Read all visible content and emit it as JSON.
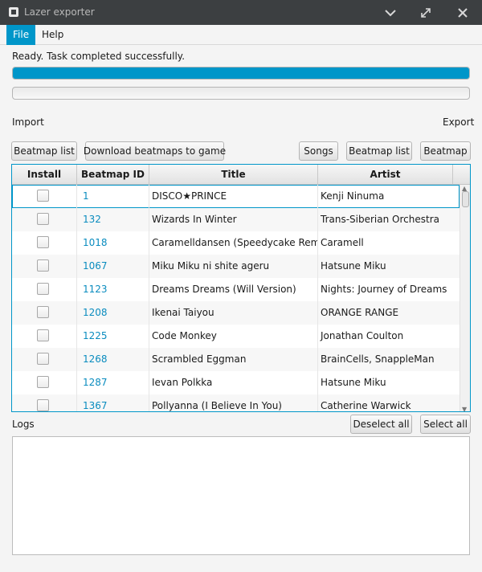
{
  "window": {
    "title": "Lazer exporter"
  },
  "menu": {
    "items": [
      "File",
      "Help"
    ]
  },
  "status_text": "Ready. Task completed successfully.",
  "progress": [
    1.0,
    0.0
  ],
  "import": {
    "label": "Import",
    "beatmap_list": "Beatmap list",
    "download": "Download beatmaps to game"
  },
  "export": {
    "label": "Export",
    "songs": "Songs",
    "beatmap_list": "Beatmap list",
    "beatmap": "Beatmap"
  },
  "table": {
    "columns": [
      "Install",
      "Beatmap ID",
      "Title",
      "Artist"
    ],
    "rows": [
      {
        "id": "1",
        "title": "DISCO★PRINCE",
        "artist": "Kenji Ninuma",
        "install": false
      },
      {
        "id": "132",
        "title": "Wizards In Winter",
        "artist": "Trans-Siberian Orchestra",
        "install": false
      },
      {
        "id": "1018",
        "title": "Caramelldansen (Speedycake Remix)",
        "artist": "Caramell",
        "install": false
      },
      {
        "id": "1067",
        "title": "Miku Miku ni shite ageru",
        "artist": "Hatsune Miku",
        "install": false
      },
      {
        "id": "1123",
        "title": "Dreams Dreams (Will Version)",
        "artist": "Nights: Journey of Dreams",
        "install": false
      },
      {
        "id": "1208",
        "title": "Ikenai Taiyou",
        "artist": "ORANGE RANGE",
        "install": false
      },
      {
        "id": "1225",
        "title": "Code Monkey",
        "artist": "Jonathan Coulton",
        "install": false
      },
      {
        "id": "1268",
        "title": "Scrambled Eggman",
        "artist": "BrainCells, SnappleMan",
        "install": false
      },
      {
        "id": "1287",
        "title": "Ievan Polkka",
        "artist": "Hatsune Miku",
        "install": false
      },
      {
        "id": "1367",
        "title": "Pollyanna (I Believe In You)",
        "artist": "Catherine Warwick",
        "install": false
      }
    ]
  },
  "logs": {
    "label": "Logs",
    "deselect_all": "Deselect all",
    "select_all": "Select all",
    "content": ""
  },
  "colors": {
    "accent": "#0096c9",
    "titlebar": "#3c3f41",
    "link_id": "#0a8cbf"
  },
  "icons": [
    "app-icon",
    "minimize-chevron-icon",
    "maximize-icon",
    "close-icon",
    "scroll-up-icon",
    "scroll-down-icon"
  ]
}
